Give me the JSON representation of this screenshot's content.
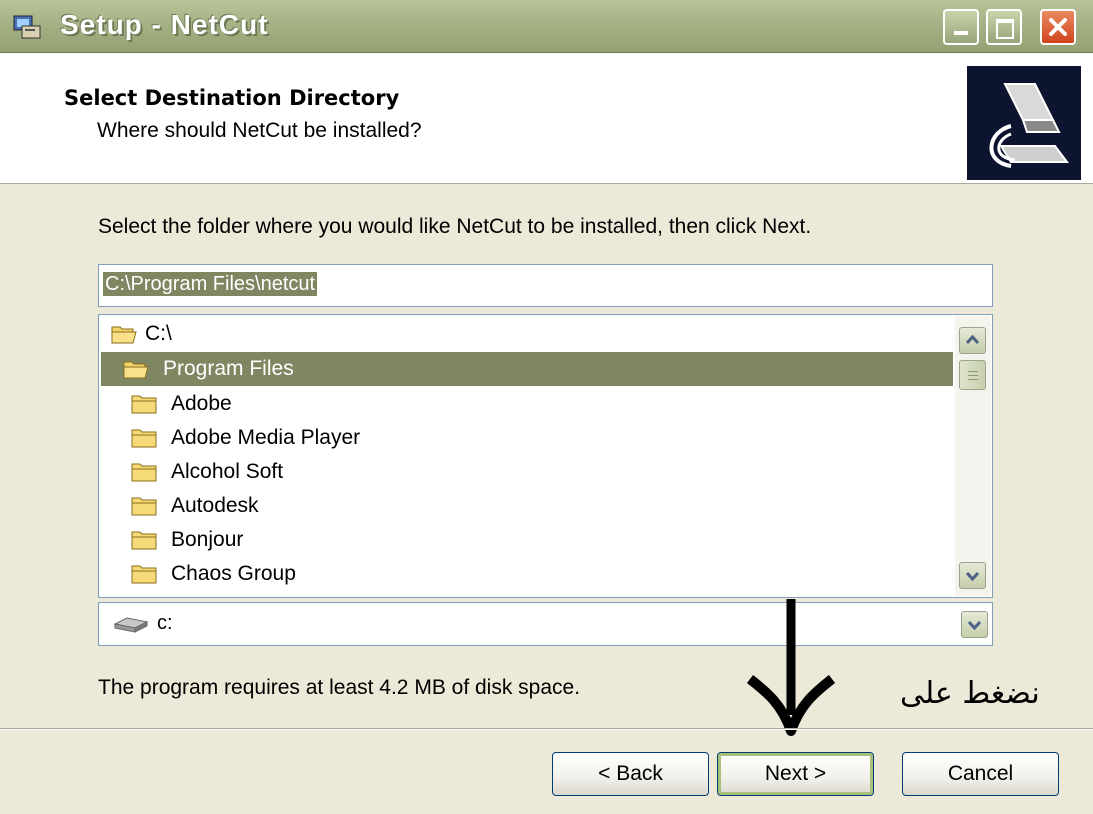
{
  "window": {
    "title": "Setup - NetCut",
    "controls": [
      "minimize-icon",
      "maximize-icon",
      "close-icon"
    ]
  },
  "header": {
    "title": "Select Destination Directory",
    "subtitle": "Where should NetCut be installed?",
    "logo_icon": "computer-install-icon"
  },
  "body": {
    "instruction": "Select the folder where you would like NetCut to be installed, then click Next.",
    "path_value": "C:\\Program Files\\netcut",
    "folders": [
      {
        "label": "C:\\",
        "selected": false
      },
      {
        "label": "Program Files",
        "selected": true
      },
      {
        "label": "Adobe",
        "selected": false
      },
      {
        "label": "Adobe Media Player",
        "selected": false
      },
      {
        "label": "Alcohol Soft",
        "selected": false
      },
      {
        "label": "Autodesk",
        "selected": false
      },
      {
        "label": "Bonjour",
        "selected": false
      },
      {
        "label": "Chaos Group",
        "selected": false
      }
    ],
    "drive": "c:",
    "space_text": "The program requires at least 4.2 MB of disk space."
  },
  "annotation": {
    "arabic_text": "نضغط على"
  },
  "buttons": {
    "back": "< Back",
    "next": "Next >",
    "cancel": "Cancel"
  },
  "colors": {
    "selection": "#7e8762",
    "titlebar": "#a5b285",
    "close": "#d1441e"
  }
}
